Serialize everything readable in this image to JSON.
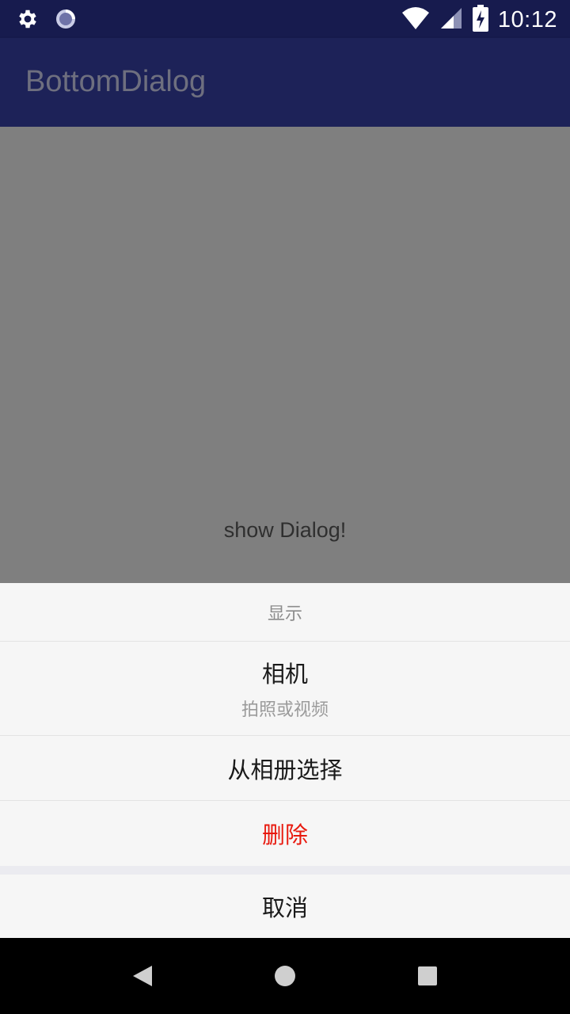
{
  "status_bar": {
    "time": "10:12",
    "icons": [
      "settings-icon",
      "sync-icon",
      "wifi-icon",
      "signal-icon",
      "battery-charging-icon"
    ]
  },
  "app_bar": {
    "title": "BottomDialog"
  },
  "content": {
    "show_dialog_label": "show Dialog!"
  },
  "bottom_sheet": {
    "title": "显示",
    "items": [
      {
        "label": "相机",
        "sublabel": "拍照或视频"
      },
      {
        "label": "从相册选择"
      },
      {
        "label": "删除",
        "color": "#e8190e"
      }
    ],
    "cancel_label": "取消"
  },
  "nav_bar": {
    "icons": [
      "back-icon",
      "home-icon",
      "recents-icon"
    ]
  },
  "colors": {
    "status_bar": "#171b4e",
    "app_bar": "#1d2258",
    "scrim": "#7f7f7f",
    "destructive": "#e8190e"
  }
}
